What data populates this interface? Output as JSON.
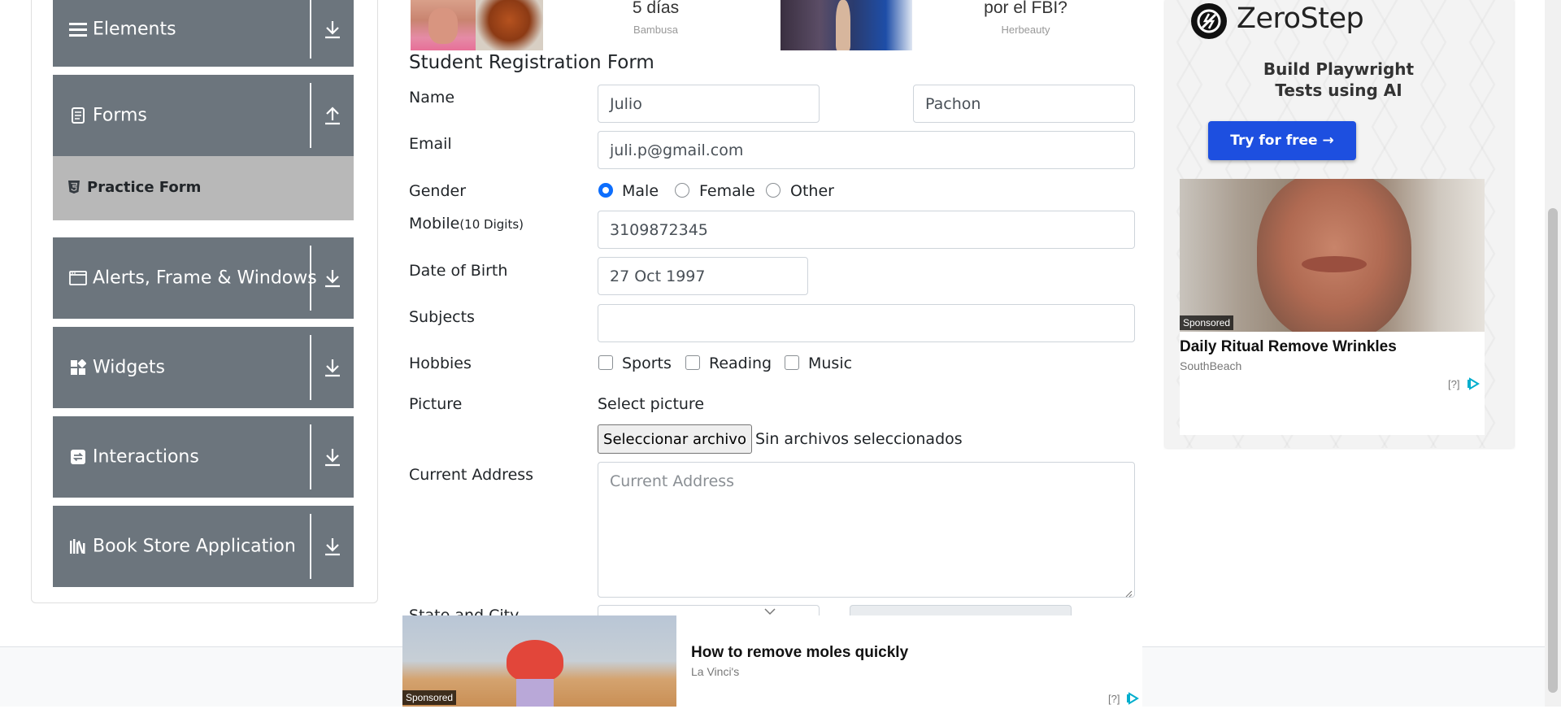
{
  "sidebar": {
    "groups": [
      {
        "label": "Elements",
        "icon": "hamburger-icon",
        "arrow": "download-arrow-icon"
      },
      {
        "label": "Forms",
        "icon": "document-icon",
        "arrow": "upload-arrow-icon"
      },
      {
        "label": "Alerts, Frame & Windows",
        "icon": "window-icon",
        "arrow": "download-arrow-icon"
      },
      {
        "label": "Widgets",
        "icon": "widgets-icon",
        "arrow": "download-arrow-icon"
      },
      {
        "label": "Interactions",
        "icon": "interactions-icon",
        "arrow": "download-arrow-icon"
      },
      {
        "label": "Book Store Application",
        "icon": "books-icon",
        "arrow": "download-arrow-icon"
      }
    ],
    "active_item": {
      "label": "Practice Form",
      "icon": "html5-icon"
    }
  },
  "top_ads": [
    {
      "title": "5 días",
      "source": "Bambusa"
    },
    {
      "title": "por el FBI?",
      "source": "Herbeauty"
    }
  ],
  "form": {
    "title": "Student Registration Form",
    "labels": {
      "name": "Name",
      "email": "Email",
      "gender": "Gender",
      "mobile": "Mobile",
      "mobile_hint": "(10 Digits)",
      "dob": "Date of Birth",
      "subjects": "Subjects",
      "hobbies": "Hobbies",
      "picture": "Picture",
      "address": "Current Address",
      "state_city": "State and City"
    },
    "first_name": "Julio",
    "last_name": "Pachon",
    "email": "juli.p@gmail.com",
    "gender_options": [
      "Male",
      "Female",
      "Other"
    ],
    "gender_selected": "Male",
    "mobile": "3109872345",
    "dob": "27 Oct 1997",
    "subjects": "",
    "hobbies": [
      "Sports",
      "Reading",
      "Music"
    ],
    "picture_prompt": "Select picture",
    "file_button": "Seleccionar archivo",
    "file_status": "Sin archivos seleccionados",
    "address_placeholder": "Current Address"
  },
  "right_ad": {
    "brand": "ZeroStep",
    "subtitle_line1": "Build Playwright",
    "subtitle_line2": "Tests using AI",
    "cta": "Try for free →",
    "sponsored": "Sponsored",
    "headline": "Daily Ritual Remove Wrinkles",
    "source": "SouthBeach",
    "info": "[?]"
  },
  "bottom_ad": {
    "sponsored": "Sponsored",
    "headline": "How to remove moles quickly",
    "source": "La Vinci's",
    "info": "[?]"
  },
  "colors": {
    "sidebar_group": "#6c757d",
    "sidebar_active": "#b8b8b8",
    "accent_blue": "#0d6efd",
    "cta_blue": "#1d4fe0"
  }
}
